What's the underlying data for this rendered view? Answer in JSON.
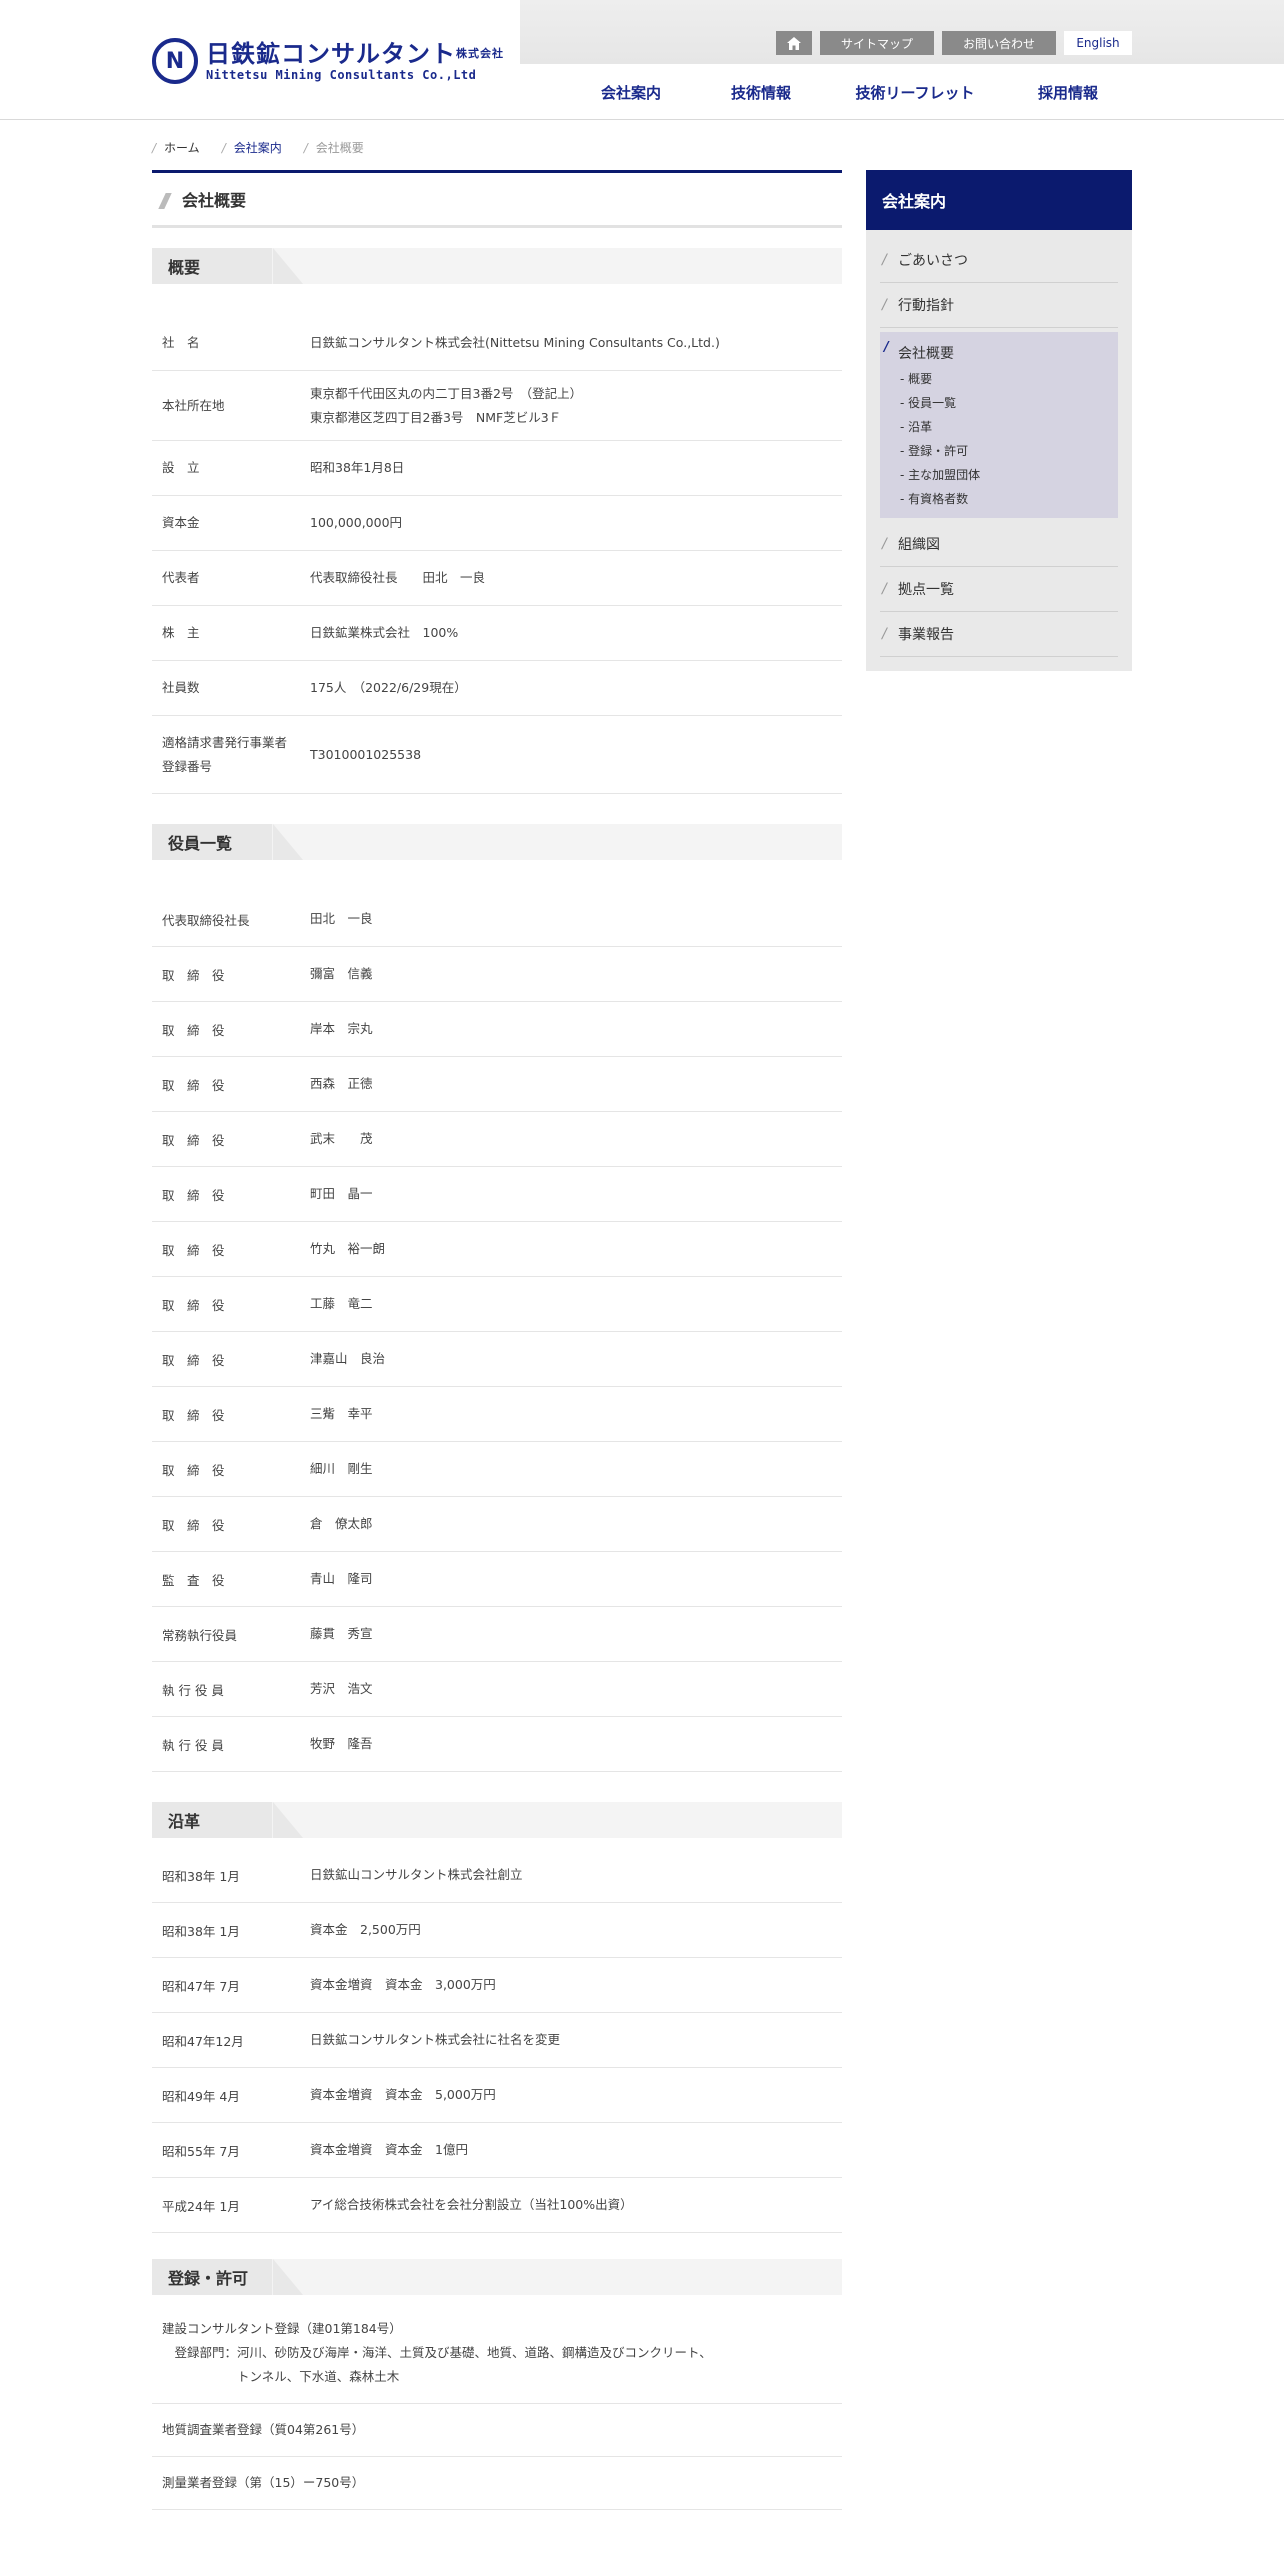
{
  "header": {
    "logo_mark": "N",
    "logo_jp": "日鉄鉱コンサルタント",
    "logo_jp_suffix": "株式会社",
    "logo_en": "Nittetsu Mining Consultants Co.,Ltd",
    "util": {
      "home_icon": "home-icon",
      "sitemap": "サイトマップ",
      "contact": "お問い合わせ",
      "english": "English"
    },
    "nav": [
      "会社案内",
      "技術情報",
      "技術リーフレット",
      "採用情報"
    ]
  },
  "breadcrumb": [
    "ホーム",
    "会社案内",
    "会社概要"
  ],
  "page_title": "会社概要",
  "overview": {
    "heading": "概要",
    "rows": [
      {
        "k": "社　名",
        "v": [
          "日鉄鉱コンサルタント株式会社(Nittetsu Mining Consultants Co.,Ltd.)"
        ]
      },
      {
        "k": "本社所在地",
        "v": [
          "東京都千代田区丸の内二丁目3番2号　（登記上）",
          "東京都港区芝四丁目2番3号　NMF芝ビル3Ｆ"
        ]
      },
      {
        "k": "設　立",
        "v": [
          "昭和38年1月8日"
        ]
      },
      {
        "k": "資本金",
        "v": [
          "100,000,000円"
        ]
      },
      {
        "k": "代表者",
        "v": [
          "代表取締役社長　　田北　一良"
        ]
      },
      {
        "k": "株　主",
        "v": [
          "日鉄鉱業株式会社　100%"
        ]
      },
      {
        "k": "社員数",
        "v": [
          "175人　（2022/6/29現在）"
        ]
      },
      {
        "k": [
          "適格請求書発行事業者",
          "登録番号"
        ],
        "v": [
          "T3010001025538"
        ]
      }
    ]
  },
  "officers": {
    "heading": "役員一覧",
    "rows": [
      {
        "k": "代表取締役社長",
        "v": "田北　一良"
      },
      {
        "k": "取　締　役",
        "v": "彌富　信義"
      },
      {
        "k": "取　締　役",
        "v": "岸本　宗丸"
      },
      {
        "k": "取　締　役",
        "v": "西森　正徳"
      },
      {
        "k": "取　締　役",
        "v": "武末　　茂"
      },
      {
        "k": "取　締　役",
        "v": "町田　晶一"
      },
      {
        "k": "取　締　役",
        "v": "竹丸　裕一朗"
      },
      {
        "k": "取　締　役",
        "v": "工藤　竜二"
      },
      {
        "k": "取　締　役",
        "v": "津嘉山　良治"
      },
      {
        "k": "取　締　役",
        "v": "三觜　幸平"
      },
      {
        "k": "取　締　役",
        "v": "細川　剛生"
      },
      {
        "k": "取　締　役",
        "v": "倉　僚太郎"
      },
      {
        "k": "監　査　役",
        "v": "青山　隆司"
      },
      {
        "k": "常務執行役員",
        "v": "藤貫　秀宣"
      },
      {
        "k": "執 行 役 員",
        "v": "芳沢　浩文"
      },
      {
        "k": "執 行 役 員",
        "v": "牧野　隆吾"
      }
    ]
  },
  "history": {
    "heading": "沿革",
    "rows": [
      {
        "k": "昭和38年 1月",
        "v": "日鉄鉱山コンサルタント株式会社創立"
      },
      {
        "k": "昭和38年 1月",
        "v": "資本金　2,500万円"
      },
      {
        "k": "昭和47年 7月",
        "v": "資本金増資　資本金　3,000万円"
      },
      {
        "k": "昭和47年12月",
        "v": "日鉄鉱コンサルタント株式会社に社名を変更"
      },
      {
        "k": "昭和49年 4月",
        "v": "資本金増資　資本金　5,000万円"
      },
      {
        "k": "昭和55年 7月",
        "v": "資本金増資　資本金　1億円"
      },
      {
        "k": "平成24年 1月",
        "v": "アイ総合技術株式会社を会社分割設立（当社100%出資）"
      }
    ]
  },
  "licenses": {
    "heading": "登録・許可",
    "items": [
      [
        "建設コンサルタント登録（建01第184号）",
        "　登録部門：河川、砂防及び海岸・海洋、土質及び基礎、地質、道路、鋼構造及びコンクリート、",
        "　　　　　　トンネル、下水道、森林土木"
      ],
      [
        "地質調査業者登録（質04第261号）"
      ],
      [
        "測量業者登録（第（15）ー750号）"
      ]
    ]
  },
  "sidebar": {
    "title": "会社案内",
    "items_before": [
      "ごあいさつ",
      "行動指針"
    ],
    "active": {
      "label": "会社概要",
      "subs": [
        "- 概要",
        "- 役員一覧",
        "- 沿革",
        "- 登録・許可",
        "- 主な加盟団体",
        "- 有資格者数"
      ]
    },
    "items_after": [
      "組織図",
      "拠点一覧",
      "事業報告"
    ]
  }
}
